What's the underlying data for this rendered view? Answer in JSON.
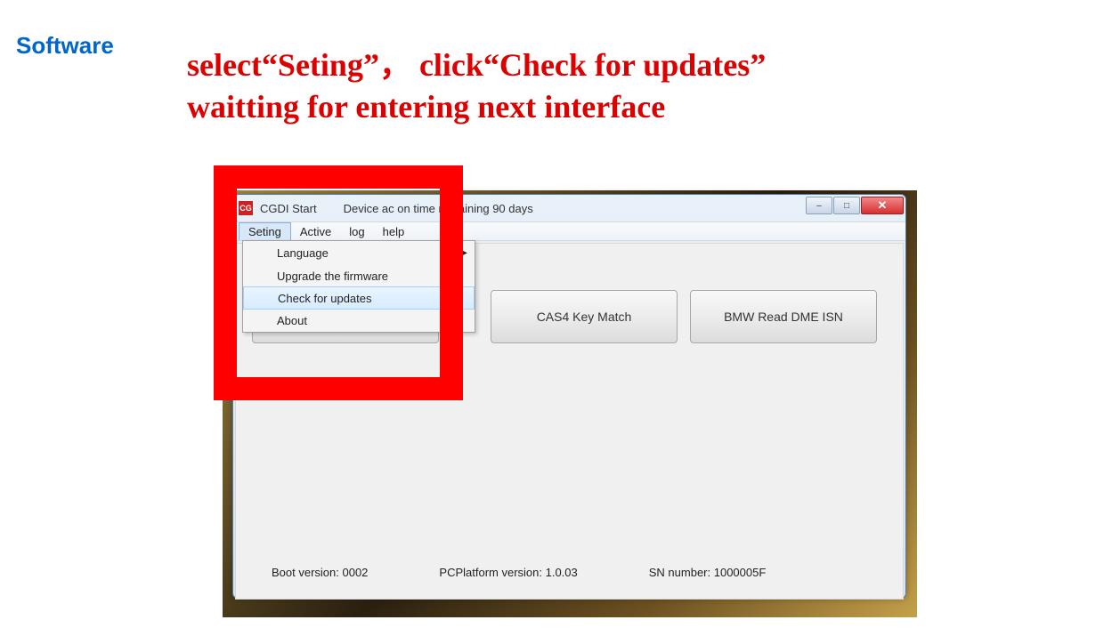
{
  "header": {
    "software_label": "Software",
    "instruction_line1": "select“Seting”，  click“Check for updates”",
    "instruction_line2": " waitting for entering next interface"
  },
  "window": {
    "icon_text": "CG",
    "title": "CGDI Start",
    "status": "Device ac           on time remaining 90 days",
    "controls": {
      "min": "–",
      "max": "□",
      "close": "✕"
    }
  },
  "menubar": {
    "items": [
      {
        "label": "Seting",
        "open": true
      },
      {
        "label": "Active"
      },
      {
        "label": "log"
      },
      {
        "label": "help"
      }
    ]
  },
  "dropdown": {
    "items": [
      {
        "label": "Language",
        "has_submenu": true
      },
      {
        "label": "Upgrade the firmware"
      },
      {
        "label": "Check for updates",
        "highlighted": true
      },
      {
        "label": "About"
      }
    ]
  },
  "buttons": {
    "b1": "",
    "b2": "CAS4 Key Match",
    "b3": "BMW Read DME ISN"
  },
  "footer": {
    "boot": "Boot version: 0002",
    "platform": "PCPlatform version:  1.0.03",
    "sn": "SN number:  1000005F"
  }
}
